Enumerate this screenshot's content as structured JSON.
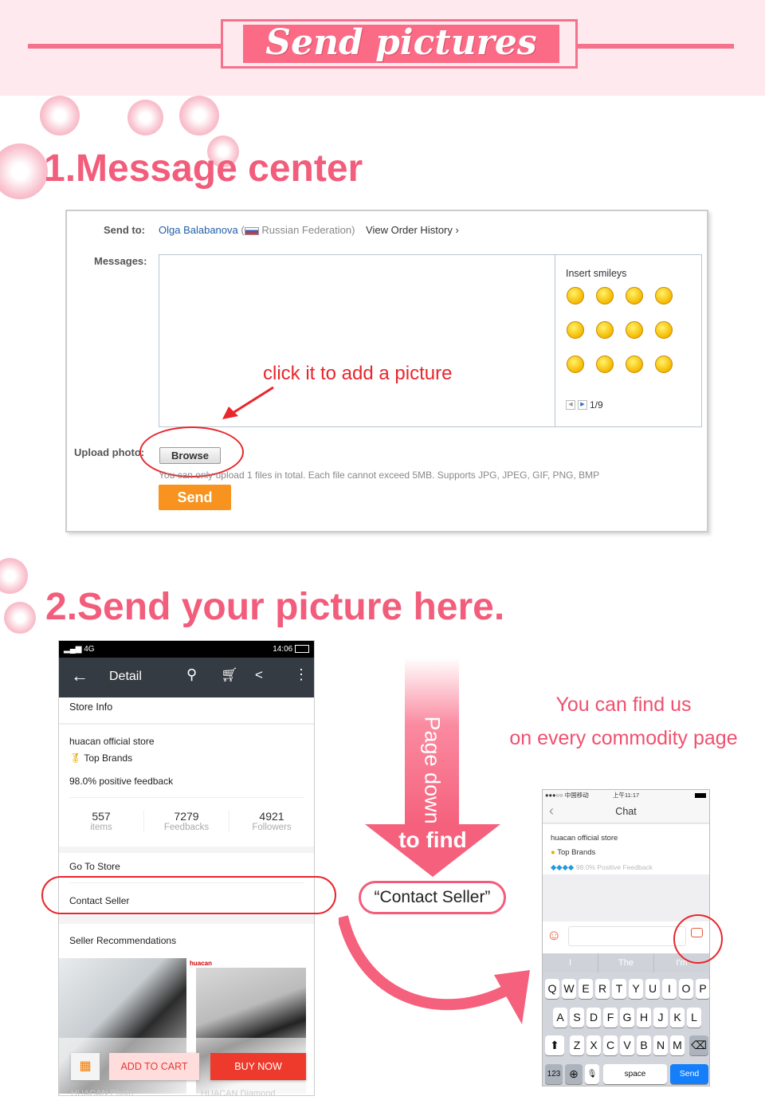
{
  "banner": {
    "title": "Send pictures"
  },
  "section1": {
    "heading": "1.Message center",
    "send_to_label": "Send to:",
    "recipient": "Olga Balabanova",
    "country": "Russian Federation)",
    "open_paren": "(",
    "view_order_history": "View Order History ›",
    "messages_label": "Messages:",
    "insert_smileys": "Insert smileys",
    "smiley_page": "1/9",
    "annotation": "click it to add a picture",
    "upload_label": "Upload photo:",
    "browse": "Browse",
    "upload_hint": "You can only upload 1 files in total. Each file cannot exceed 5MB. Supports JPG, JPEG, GIF, PNG, BMP",
    "send": "Send"
  },
  "section2": {
    "heading": "2.Send your picture here.",
    "page_down": "Page down",
    "to_find": "to find",
    "contact_seller_callout": "“Contact Seller”",
    "find_us_line1": "You can find us",
    "find_us_line2": "on every commodity page"
  },
  "phone1": {
    "status_left": "4G",
    "time": "14:06",
    "title": "Detail",
    "store_info": "Store Info",
    "store_name": "huacan official store",
    "top_brands": "Top Brands",
    "feedback": "98.0% positive feedback",
    "stats": [
      {
        "value": "557",
        "label": "items"
      },
      {
        "value": "7279",
        "label": "Feedbacks"
      },
      {
        "value": "4921",
        "label": "Followers"
      }
    ],
    "go_to_store": "Go To Store",
    "contact_seller": "Contact Seller",
    "recommendations": "Seller Recommendations",
    "brand_logo": "huacan",
    "add_to_cart": "ADD TO CART",
    "buy_now": "BUY NOW",
    "product1": "HUACAN Photo",
    "product2": "HUACAN Diamond"
  },
  "phone2": {
    "carrier": "●●●○○ 中国移动",
    "time": "上午11:17",
    "title": "Chat",
    "store_name": "huacan official store",
    "top_brands": "Top Brands",
    "feedback": "98.0% Positive Feedback",
    "suggestions": [
      "I",
      "The",
      "I'm"
    ],
    "keys_row1": [
      "Q",
      "W",
      "E",
      "R",
      "T",
      "Y",
      "U",
      "I",
      "O",
      "P"
    ],
    "keys_row2": [
      "A",
      "S",
      "D",
      "F",
      "G",
      "H",
      "J",
      "K",
      "L"
    ],
    "keys_row3": [
      "Z",
      "X",
      "C",
      "V",
      "B",
      "N",
      "M"
    ],
    "key_123": "123",
    "space": "space",
    "send": "Send"
  },
  "colors": {
    "accent_pink": "#f25d7b",
    "banner": "#fc6b86",
    "annotation_red": "#e8262c",
    "send_orange": "#f7931e",
    "ios_blue": "#147efb"
  }
}
